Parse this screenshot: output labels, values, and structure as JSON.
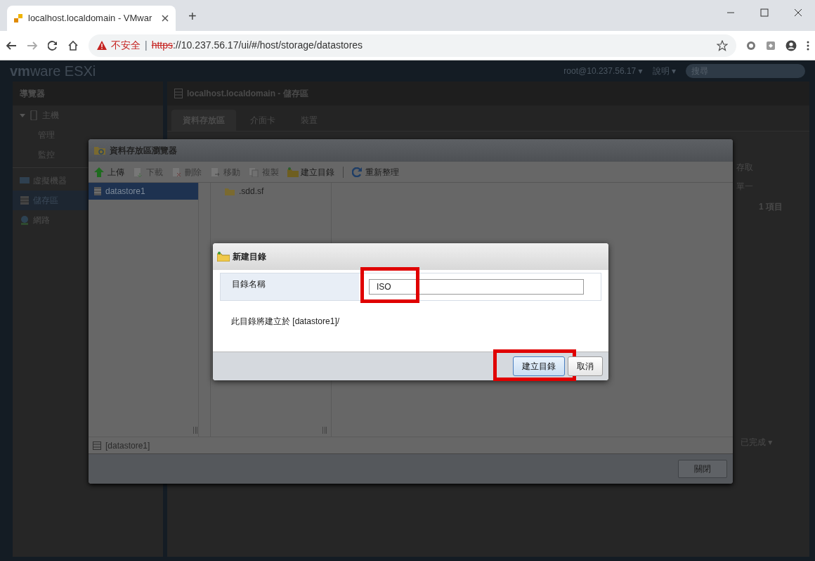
{
  "browser": {
    "tab_title": "localhost.localdomain - VMwar",
    "new_tab": "+",
    "security": "不安全",
    "divider": "|",
    "url_scheme": "https",
    "url_rest": "://10.237.56.17/ui/#/host/storage/datastores"
  },
  "header": {
    "logo": "**vm**ware ESXi",
    "user_menu": "root@10.237.56.17 ▾",
    "help_menu": "說明 ▾",
    "search": {
      "placeholder": "搜尋"
    }
  },
  "navigator": {
    "title": "導覽器",
    "items": [
      {
        "label": "主機",
        "kind": "host",
        "selected": false,
        "expanded": true,
        "children": [
          {
            "label": "管理",
            "selected": false
          },
          {
            "label": "監控",
            "selected": false
          }
        ]
      },
      {
        "label": "虛擬機器",
        "kind": "vm",
        "selected": false
      },
      {
        "label": "儲存區",
        "kind": "storage",
        "selected": true
      },
      {
        "label": "網路",
        "kind": "network",
        "selected": false
      }
    ]
  },
  "content": {
    "title": "localhost.localdomain - 儲存區",
    "tabs": [
      {
        "label": "資料存放區",
        "selected": true
      },
      {
        "label": "介面卡",
        "selected": false
      },
      {
        "label": "裝置",
        "selected": false
      }
    ],
    "column_1": "存取",
    "cell_1": "單一",
    "count": "1 項目",
    "tasks_status": "已完成 ▾"
  },
  "datastore_browser": {
    "title": "資料存放區瀏覽器",
    "toolbar": [
      {
        "label": "上傳",
        "kind": "upload",
        "disabled": false
      },
      {
        "label": "下載",
        "kind": "download",
        "disabled": true
      },
      {
        "label": "刪除",
        "kind": "delete",
        "disabled": true
      },
      {
        "label": "移動",
        "kind": "move",
        "disabled": true
      },
      {
        "label": "複製",
        "kind": "copy",
        "disabled": true
      },
      {
        "label": "建立目錄",
        "kind": "folder",
        "disabled": false
      },
      {
        "label": "重新整理",
        "kind": "refresh",
        "disabled": false
      }
    ],
    "datastores": [
      {
        "label": "datastore1",
        "selected": true
      }
    ],
    "files": [
      {
        "label": ".sdd.sf",
        "selected": false
      }
    ],
    "path": "[datastore1]",
    "close_button": "關閉"
  },
  "new_folder_dialog": {
    "title": "新建目錄",
    "field_label": "目錄名稱",
    "field": {
      "value": "ISO",
      "highlighted": true
    },
    "message": "此目錄將建立於 [datastore1]/",
    "buttons": [
      {
        "label": "建立目錄",
        "kind": "primary",
        "highlighted": true
      },
      {
        "label": "取消",
        "kind": "secondary",
        "highlighted": false
      }
    ]
  }
}
